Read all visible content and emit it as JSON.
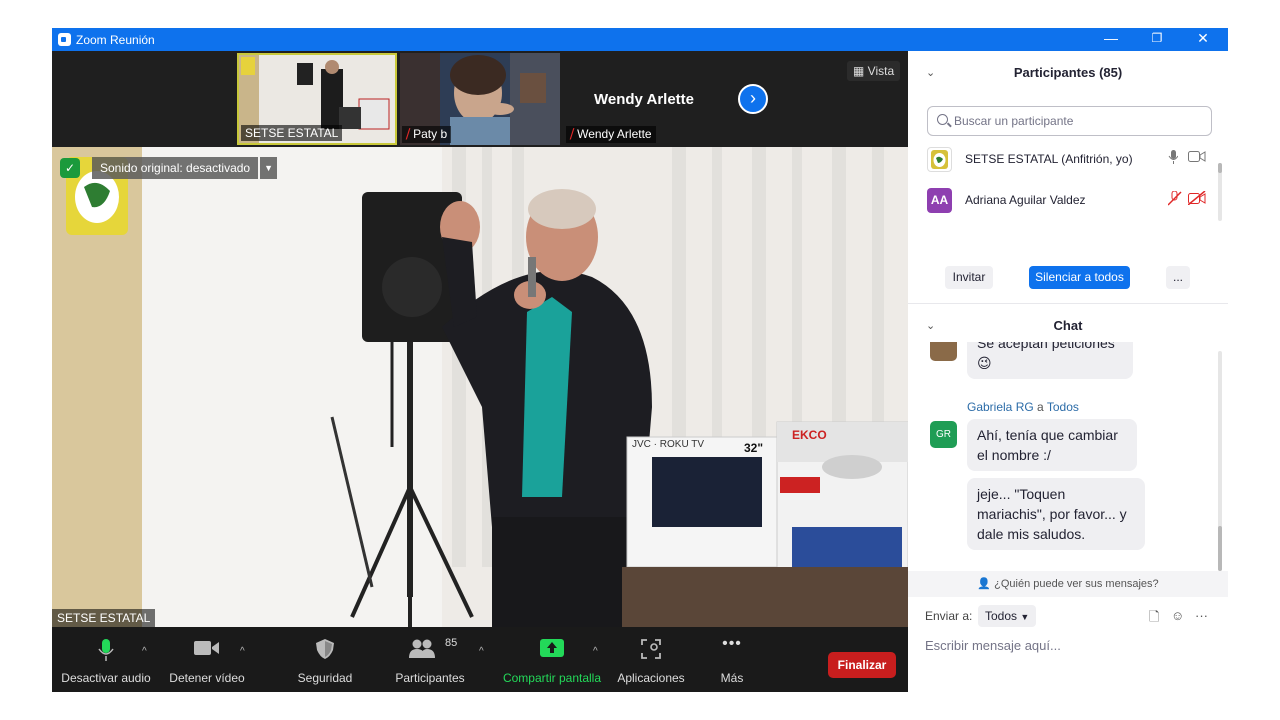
{
  "window": {
    "title": "Zoom Reunión",
    "minimize": "—",
    "restore": "❐",
    "close": "✕"
  },
  "thumbnails": [
    {
      "label": "SETSE ESTATAL",
      "muted": false
    },
    {
      "label": "Paty b",
      "muted": true
    },
    {
      "label": "Wendy  Arlette",
      "muted": true,
      "display_name": "Wendy  Arlette"
    }
  ],
  "next_arrow": "›",
  "vista_label": "Vista",
  "original_sound": "Sonido original: desactivado",
  "speaker_label": "SETSE ESTATAL",
  "toolbar": {
    "audio": "Desactivar audio",
    "video": "Detener vídeo",
    "security": "Seguridad",
    "participants": "Participantes",
    "participants_count": "85",
    "share": "Compartir pantalla",
    "apps": "Aplicaciones",
    "more": "Más",
    "end": "Finalizar"
  },
  "participants_panel": {
    "title": "Participantes (85)",
    "search_placeholder": "Buscar un participante",
    "rows": [
      {
        "name": "SETSE ESTATAL (Anfitrión, yo)",
        "avatar": "",
        "avatar_color": "#d6c13a"
      },
      {
        "name": "Adriana Aguilar Valdez",
        "avatar": "AA",
        "avatar_color": "#8e3fb0"
      }
    ],
    "invite": "Invitar",
    "mute_all": "Silenciar a todos",
    "more": "..."
  },
  "chat": {
    "title": "Chat",
    "messages": [
      {
        "text": "Se aceptan peticiones",
        "emoji": "😉"
      },
      {
        "sender": "Gabriela RG",
        "connector": "a",
        "recipient": "Todos",
        "avatar": "GR",
        "avatar_color": "#1f9d55"
      },
      {
        "text": "Ahí, tenía que cambiar el nombre :/"
      },
      {
        "text": "jeje... \"Toquen mariachis\", por favor... y dale mis saludos."
      }
    ],
    "who_sees": "¿Quién puede ver sus mensajes?",
    "send_to_label": "Enviar a:",
    "send_to_value": "Todos",
    "input_placeholder": "Escribir mensaje aquí..."
  },
  "colors": {
    "accent": "#0e72ed",
    "end_red": "#c81e1e",
    "share_green": "#23d959",
    "mic_green": "#23d959"
  }
}
